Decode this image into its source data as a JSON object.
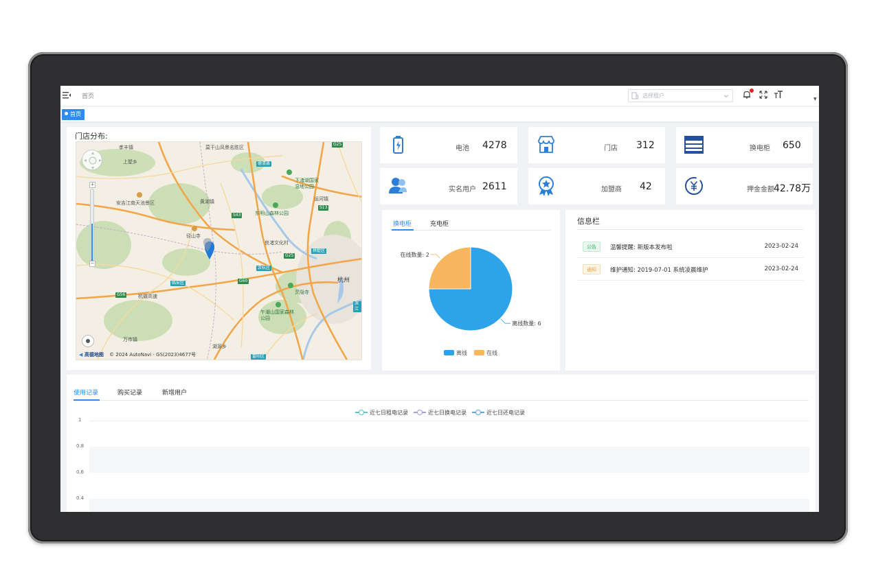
{
  "header": {
    "breadcrumb": "首页",
    "tenant_placeholder": "选择租户"
  },
  "tags": [
    {
      "label": "首页"
    }
  ],
  "map": {
    "title": "门店分布:",
    "labels": {
      "l1": "孝丰镇",
      "l2": "莫干山风景名胜区",
      "l3": "德清县",
      "l4": "上墅乡",
      "l5": "下渚湖国家湿地公园",
      "l6": "安吉江南天池景区",
      "l7": "黄湖镇",
      "l8": "东明山森林公园",
      "l9": "运河镇",
      "l10": "径山寺",
      "l11": "良渚文化村",
      "l12": "拱墅区",
      "l13": "余杭区",
      "l14": "杭州",
      "l15": "临安区",
      "l16": "杭徽高速",
      "l17": "灵隐寺",
      "l18": "午潮山国家森林公园",
      "l19": "万市镇",
      "l20": "富阳区",
      "l21": "湖源乡",
      "l22": "滨江"
    },
    "roads": [
      "G25",
      "S13",
      "S43",
      "G25",
      "G56",
      "G60"
    ],
    "attribution_logo": "高德地图",
    "attribution": "© 2024 AutoNavi - GS(2023)4677号"
  },
  "stats": [
    {
      "label": "电池",
      "value": "4278",
      "icon": "battery-icon"
    },
    {
      "label": "门店",
      "value": "312",
      "icon": "store-icon"
    },
    {
      "label": "换电柜",
      "value": "650",
      "icon": "cabinet-icon"
    },
    {
      "label": "实名用户",
      "value": "2611",
      "icon": "user-icon"
    },
    {
      "label": "加盟商",
      "value": "42",
      "icon": "medal-icon"
    },
    {
      "label": "押金金额",
      "value": "42.78万",
      "icon": "yen-icon"
    }
  ],
  "cabinet_panel": {
    "tabs": [
      "换电柜",
      "充电柜"
    ],
    "chart_data": {
      "type": "pie",
      "slices": [
        {
          "name": "离线",
          "label": "离线数量: 6",
          "value": 6,
          "color": "#2ea3ea"
        },
        {
          "name": "在线",
          "label": "在线数量: 2",
          "value": 2,
          "color": "#f8b65e"
        }
      ],
      "legend": [
        "离线",
        "在线"
      ],
      "legend_position": "bottom"
    }
  },
  "info": {
    "title": "信息栏",
    "items": [
      {
        "badge": "公告",
        "text": "温馨提醒: 新版本发布啦",
        "date": "2023-02-24"
      },
      {
        "badge": "通知",
        "text": "维护通知: 2019-07-01 系统凌晨维护",
        "date": "2023-02-24"
      }
    ]
  },
  "records": {
    "tabs": [
      "使用记录",
      "购买记录",
      "新增用户"
    ],
    "chart_data": {
      "type": "line",
      "series": [
        {
          "name": "近七日租电记录",
          "color": "#5ec4c8",
          "values": []
        },
        {
          "name": "近七日换电记录",
          "color": "#a99cd8",
          "values": []
        },
        {
          "name": "近七日还电记录",
          "color": "#5fa5d8",
          "values": []
        }
      ],
      "y_ticks": [
        "1",
        "0.8",
        "0.6",
        "0.4"
      ],
      "legend_position": "top"
    }
  }
}
